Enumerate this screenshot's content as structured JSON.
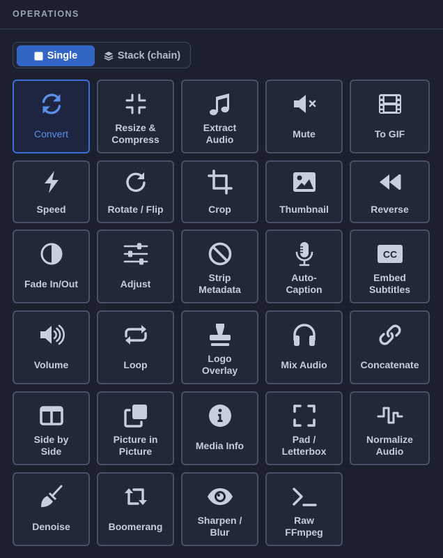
{
  "header": {
    "title": "OPERATIONS"
  },
  "mode": {
    "single_label": "Single",
    "stack_label": "Stack (chain)",
    "selected": "Single"
  },
  "colors": {
    "accent": "#3366c4",
    "active_text": "#5b8ee8",
    "background": "#1b1f2e",
    "tile_border": "#4a4f68"
  },
  "operations": [
    {
      "label": "Convert",
      "icon": "refresh-icon",
      "active": true
    },
    {
      "label": "Resize &\nCompress",
      "icon": "compress-icon",
      "active": false
    },
    {
      "label": "Extract\nAudio",
      "icon": "music-note-icon",
      "active": false
    },
    {
      "label": "Mute",
      "icon": "volume-mute-icon",
      "active": false
    },
    {
      "label": "To GIF",
      "icon": "film-icon",
      "active": false
    },
    {
      "label": "Speed",
      "icon": "lightning-icon",
      "active": false
    },
    {
      "label": "Rotate / Flip",
      "icon": "rotate-icon",
      "active": false
    },
    {
      "label": "Crop",
      "icon": "crop-icon",
      "active": false
    },
    {
      "label": "Thumbnail",
      "icon": "image-icon",
      "active": false
    },
    {
      "label": "Reverse",
      "icon": "backward-icon",
      "active": false
    },
    {
      "label": "Fade In/Out",
      "icon": "half-circle-icon",
      "active": false
    },
    {
      "label": "Adjust",
      "icon": "sliders-icon",
      "active": false
    },
    {
      "label": "Strip\nMetadata",
      "icon": "ban-icon",
      "active": false
    },
    {
      "label": "Auto-\nCaption",
      "icon": "microphone-icon",
      "active": false
    },
    {
      "label": "Embed\nSubtitles",
      "icon": "closed-captions-icon",
      "active": false
    },
    {
      "label": "Volume",
      "icon": "volume-high-icon",
      "active": false
    },
    {
      "label": "Loop",
      "icon": "repeat-icon",
      "active": false
    },
    {
      "label": "Logo\nOverlay",
      "icon": "stamp-icon",
      "active": false
    },
    {
      "label": "Mix Audio",
      "icon": "headphones-icon",
      "active": false
    },
    {
      "label": "Concatenate",
      "icon": "link-icon",
      "active": false
    },
    {
      "label": "Side by\nSide",
      "icon": "columns-icon",
      "active": false
    },
    {
      "label": "Picture in\nPicture",
      "icon": "clone-icon",
      "active": false
    },
    {
      "label": "Media Info",
      "icon": "info-circle-icon",
      "active": false
    },
    {
      "label": "Pad /\nLetterbox",
      "icon": "expand-icon",
      "active": false
    },
    {
      "label": "Normalize\nAudio",
      "icon": "waveform-icon",
      "active": false
    },
    {
      "label": "Denoise",
      "icon": "broom-icon",
      "active": false
    },
    {
      "label": "Boomerang",
      "icon": "retweet-icon",
      "active": false
    },
    {
      "label": "Sharpen /\nBlur",
      "icon": "eye-icon",
      "active": false
    },
    {
      "label": "Raw\nFFmpeg",
      "icon": "terminal-icon",
      "active": false
    }
  ]
}
